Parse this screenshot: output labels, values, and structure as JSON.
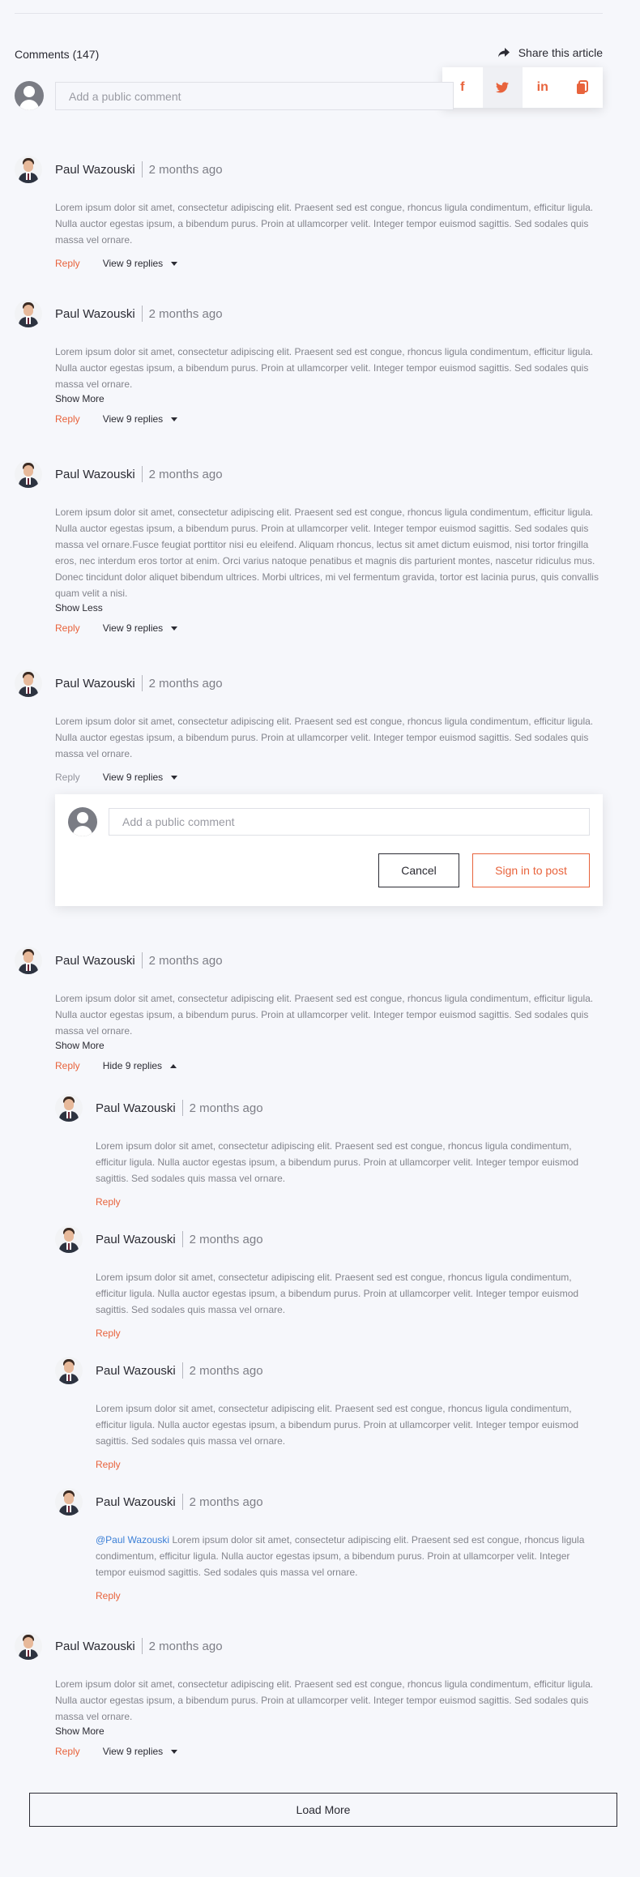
{
  "header": {
    "comments_title": "Comments (147)",
    "share_label": "Share this article",
    "share_icon": "share-arrow-icon"
  },
  "share_menu": {
    "items": [
      {
        "name": "facebook-icon",
        "glyph": "f"
      },
      {
        "name": "twitter-icon",
        "glyph": "🐦"
      },
      {
        "name": "linkedin-icon",
        "glyph": "in"
      },
      {
        "name": "copy-link-icon",
        "glyph": "⧉"
      }
    ]
  },
  "new_comment": {
    "placeholder": "Add a public comment"
  },
  "comments": [
    {
      "author": "Paul Wazouski",
      "time": "2 months ago",
      "body": "Lorem ipsum dolor sit amet, consectetur adipiscing elit. Praesent sed est congue, rhoncus ligula condimentum, efficitur ligula. Nulla auctor egestas ipsum, a bibendum purus. Proin at ullamcorper velit. Integer tempor euismod sagittis. Sed sodales quis massa vel ornare.",
      "reply_label": "Reply",
      "replies_label": "View 9 replies"
    },
    {
      "author": "Paul Wazouski",
      "time": "2 months ago",
      "body": "Lorem ipsum dolor sit amet, consectetur adipiscing elit. Praesent sed est congue, rhoncus ligula condimentum, efficitur ligula. Nulla auctor egestas ipsum, a bibendum purus. Proin at ullamcorper velit. Integer tempor euismod sagittis. Sed sodales quis massa vel ornare.",
      "toggle_label": "Show More",
      "reply_label": "Reply",
      "replies_label": "View 9 replies"
    },
    {
      "author": "Paul Wazouski",
      "time": "2 months ago",
      "body": "Lorem ipsum dolor sit amet, consectetur adipiscing elit. Praesent sed est congue, rhoncus ligula condimentum, efficitur ligula. Nulla auctor egestas ipsum, a bibendum purus. Proin at ullamcorper velit. Integer tempor euismod sagittis. Sed sodales quis massa vel ornare.Fusce feugiat porttitor nisi eu eleifend. Aliquam rhoncus, lectus sit amet dictum euismod, nisi tortor fringilla eros, nec interdum eros tortor at enim. Orci varius natoque penatibus et magnis dis parturient montes, nascetur ridiculus mus. Donec tincidunt dolor aliquet bibendum ultrices. Morbi ultrices, mi vel fermentum gravida, tortor est lacinia purus, quis convallis quam velit a nisi.",
      "toggle_label": "Show Less",
      "reply_label": "Reply",
      "replies_label": "View 9 replies"
    },
    {
      "author": "Paul Wazouski",
      "time": "2 months ago",
      "body": "Lorem ipsum dolor sit amet, consectetur adipiscing elit. Praesent sed est congue, rhoncus ligula condimentum, efficitur ligula. Nulla auctor egestas ipsum, a bibendum purus. Proin at ullamcorper velit. Integer tempor euismod sagittis. Sed sodales quis massa vel ornare.",
      "reply_label": "Reply",
      "replies_label": "View 9 replies"
    },
    {
      "author": "Paul Wazouski",
      "time": "2 months ago",
      "body": "Lorem ipsum dolor sit amet, consectetur adipiscing elit. Praesent sed est congue, rhoncus ligula condimentum, efficitur ligula. Nulla auctor egestas ipsum, a bibendum purus. Proin at ullamcorper velit. Integer tempor euismod sagittis. Sed sodales quis massa vel ornare.",
      "toggle_label": "Show More",
      "reply_label": "Reply",
      "replies_label": "Hide 9 replies"
    },
    {
      "author": "Paul Wazouski",
      "time": "2 months ago",
      "body": "Lorem ipsum dolor sit amet, consectetur adipiscing elit. Praesent sed est congue, rhoncus ligula condimentum, efficitur ligula. Nulla auctor egestas ipsum, a bibendum purus. Proin at ullamcorper velit. Integer tempor euismod sagittis. Sed sodales quis massa vel ornare.",
      "toggle_label": "Show More",
      "reply_label": "Reply",
      "replies_label": "View 9 replies"
    }
  ],
  "replies": [
    {
      "author": "Paul Wazouski",
      "time": "2 months ago",
      "body": "Lorem ipsum dolor sit amet, consectetur adipiscing elit. Praesent sed est congue, rhoncus ligula condimentum, efficitur ligula. Nulla auctor egestas ipsum, a bibendum purus. Proin at ullamcorper velit. Integer tempor euismod sagittis. Sed sodales quis massa vel ornare.",
      "reply_label": "Reply"
    },
    {
      "author": "Paul Wazouski",
      "time": "2 months ago",
      "body": "Lorem ipsum dolor sit amet, consectetur adipiscing elit. Praesent sed est congue, rhoncus ligula condimentum, efficitur ligula. Nulla auctor egestas ipsum, a bibendum purus. Proin at ullamcorper velit. Integer tempor euismod sagittis. Sed sodales quis massa vel ornare.",
      "reply_label": "Reply"
    },
    {
      "author": "Paul Wazouski",
      "time": "2 months ago",
      "body": "Lorem ipsum dolor sit amet, consectetur adipiscing elit. Praesent sed est congue, rhoncus ligula condimentum, efficitur ligula. Nulla auctor egestas ipsum, a bibendum purus. Proin at ullamcorper velit. Integer tempor euismod sagittis. Sed sodales quis massa vel ornare.",
      "reply_label": "Reply"
    },
    {
      "author": "Paul Wazouski",
      "time": "2 months ago",
      "mention": "@Paul Wazouski",
      "body": " Lorem ipsum dolor sit amet, consectetur adipiscing elit. Praesent sed est congue, rhoncus ligula condimentum, efficitur ligula. Nulla auctor egestas ipsum, a bibendum purus. Proin at ullamcorper velit. Integer tempor euismod sagittis. Sed sodales quis massa vel ornare.",
      "reply_label": "Reply"
    }
  ],
  "reply_box": {
    "placeholder": "Add a public comment",
    "cancel_label": "Cancel",
    "signin_label": "Sign in to post"
  },
  "load_more_label": "Load More",
  "colors": {
    "accent": "#e8633c",
    "mention": "#3b7fd6",
    "text": "#2b2b33",
    "muted": "#83848c",
    "background": "#f6f7fb"
  }
}
